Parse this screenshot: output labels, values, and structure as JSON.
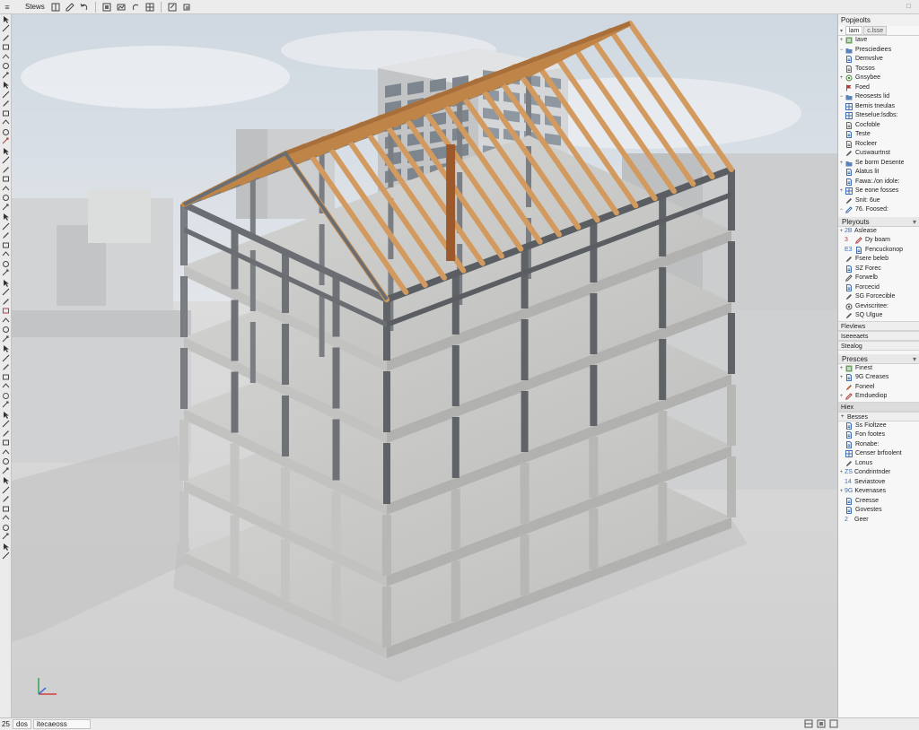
{
  "toolbar": {
    "title": "Stews",
    "buttons": [
      "view-grid-icon",
      "pen-icon",
      "undo-icon",
      "redo-icon",
      "snap-icon",
      "render-icon",
      "grid-icon",
      "export-icon"
    ]
  },
  "left_tools": [
    "arrow-icon",
    "line-icon",
    "pencil-icon",
    "wall-icon",
    "slab-icon",
    "column-icon",
    "beam-icon",
    "roof-icon",
    "brush-icon",
    "text-icon",
    "dimension-icon",
    "measure-icon",
    "paint-icon",
    "eraser-icon",
    "move-icon",
    "rotate-icon",
    "scale-icon",
    "mirror-icon",
    "array-icon",
    "offset-icon",
    "trim-icon",
    "extend-icon",
    "fillet-icon",
    "section-icon",
    "camera-icon",
    "orbit-icon",
    "pan-icon",
    "zoom-icon",
    "zoom-extents-icon",
    "layer-icon",
    "material-icon",
    "light-icon",
    "tag-icon",
    "level-icon",
    "grid-line-icon",
    "stair-icon",
    "door-icon",
    "window-icon",
    "railing-icon",
    "ramp-icon",
    "furniture-icon",
    "component-icon",
    "group-icon",
    "lock-icon",
    "hide-icon",
    "isolate-icon",
    "clip-icon",
    "print-icon",
    "save-icon",
    "lock-small-icon",
    "settings-icon",
    "help-icon",
    "info-icon",
    "plugin-icon",
    "script-icon",
    "camera2-icon",
    "render2-icon",
    "marker-icon"
  ],
  "panel": {
    "title": "Popjeolts",
    "tabs": [
      "lam",
      "c.lsse"
    ],
    "tree": [
      {
        "exp": "+",
        "icon": "layer-icon",
        "color": "#4a8a3c",
        "label": "Iave"
      },
      {
        "exp": "−",
        "icon": "folder-icon",
        "color": "#3f6fb0",
        "label": "Presciediees"
      },
      {
        "exp": "",
        "icon": "doc-icon",
        "color": "#3f6fb0",
        "label": "Demvslve"
      },
      {
        "exp": "",
        "icon": "doc-icon",
        "color": "#6a6a6a",
        "label": "Tocsos"
      },
      {
        "exp": "+",
        "icon": "shape-icon",
        "color": "#4a8a3c",
        "label": "Gnsybee"
      },
      {
        "exp": "",
        "icon": "flag-icon",
        "color": "#b04040",
        "label": "Foed"
      },
      {
        "exp": "−",
        "icon": "folder-icon",
        "color": "#3f6fb0",
        "label": "Reosests lid"
      },
      {
        "exp": "",
        "icon": "grid-icon",
        "color": "#3f6fb0",
        "label": "Bemis tneulas"
      },
      {
        "exp": "",
        "icon": "grid-icon",
        "color": "#3f6fb0",
        "label": "Steselue:lsdbs:"
      },
      {
        "exp": "",
        "icon": "doc-icon",
        "color": "#6a6a6a",
        "label": "Cocfoble"
      },
      {
        "exp": "",
        "icon": "doc-icon",
        "color": "#3f6fb0",
        "label": "Teste"
      },
      {
        "exp": "",
        "icon": "doc-icon",
        "color": "#6a6a6a",
        "label": "Rocleer"
      },
      {
        "exp": "",
        "icon": "pen-icon",
        "color": "#555555",
        "label": "Cuswaurtnst"
      },
      {
        "exp": "+",
        "icon": "folder-icon",
        "color": "#3f6fb0",
        "label": "Se borm Desente"
      },
      {
        "exp": "",
        "icon": "doc-icon",
        "color": "#3f6fb0",
        "label": "Alatus lit"
      },
      {
        "exp": "",
        "icon": "doc-icon",
        "color": "#3f6fb0",
        "label": "Fawa:./on idole:"
      },
      {
        "exp": "+",
        "icon": "grid-icon",
        "color": "#3f6fb0",
        "label": "Se eone fosses"
      },
      {
        "exp": "",
        "icon": "pen-icon",
        "color": "#555555",
        "label": "Snit: 6ue"
      },
      {
        "exp": "−",
        "icon": "pencil-icon",
        "color": "#3f6fb0",
        "label": "76. Foosed:"
      }
    ],
    "playouts_title": "Pleyouts",
    "playouts": [
      {
        "exp": "+",
        "prefix": "2B",
        "color": "#3f6fb0",
        "label": "Aslease"
      },
      {
        "exp": "",
        "prefix": "3",
        "icon": "pencil-icon",
        "color": "#b04040",
        "label": "Dy boam"
      },
      {
        "exp": "",
        "prefix": "E3",
        "icon": "doc-icon",
        "color": "#3f6fb0",
        "label": "Fencuckonop"
      },
      {
        "exp": "",
        "prefix": "",
        "icon": "pen-icon",
        "color": "#555555",
        "label": "Fsere beleb"
      },
      {
        "exp": "",
        "prefix": "",
        "icon": "doc-icon",
        "color": "#3f6fb0",
        "label": "SZ Forec"
      },
      {
        "exp": "",
        "prefix": "",
        "icon": "pencil-icon",
        "color": "#555555",
        "label": "Forwelb"
      },
      {
        "exp": "",
        "prefix": "",
        "icon": "doc-icon",
        "color": "#3f6fb0",
        "label": "Forcecid"
      },
      {
        "exp": "",
        "prefix": "",
        "icon": "pen-icon",
        "color": "#555555",
        "label": "SG Forcecible"
      },
      {
        "exp": "",
        "prefix": "",
        "icon": "shape-icon",
        "color": "#555555",
        "label": "Geviscritee:"
      },
      {
        "exp": "",
        "prefix": "",
        "icon": "pen-icon",
        "color": "#555555",
        "label": "SQ Ulgue"
      }
    ],
    "mid_sections": [
      "Flevlews",
      "Iseeeaets",
      "Stealog"
    ],
    "presets_title": "Presces",
    "presets": [
      {
        "exp": "+",
        "icon": "layer-icon",
        "color": "#4a8a3c",
        "label": "Finest"
      },
      {
        "exp": "+",
        "icon": "doc-icon",
        "color": "#3f6fb0",
        "label": "9G Creases"
      },
      {
        "exp": "",
        "icon": "pen-icon",
        "color": "#b06030",
        "label": "Foneel"
      },
      {
        "exp": "+",
        "icon": "pencil-icon",
        "color": "#b04040",
        "label": "Emduediop"
      }
    ],
    "selected_sections": [
      "Hiex",
      "Besses"
    ],
    "besses": [
      {
        "exp": "",
        "icon": "doc-icon",
        "color": "#3f6fb0",
        "label": "Ss Fioltzee"
      },
      {
        "exp": "",
        "icon": "doc-icon",
        "color": "#3f6fb0",
        "label": "Fon footes"
      },
      {
        "exp": "",
        "icon": "doc-icon",
        "color": "#3f6fb0",
        "label": "Ronabe:"
      },
      {
        "exp": "",
        "icon": "grid-icon",
        "color": "#3f6fb0",
        "label": "Censer brfoolent"
      },
      {
        "exp": "",
        "icon": "pen-icon",
        "color": "#555555",
        "label": "Lonus"
      },
      {
        "exp": "+",
        "prefix": "ZS",
        "color": "#3f6fb0",
        "label": "Condrintnder"
      },
      {
        "exp": "",
        "prefix": "14",
        "color": "#3f6fb0",
        "label": "Seviastove"
      },
      {
        "exp": "+",
        "prefix": "9G",
        "color": "#3f6fb0",
        "label": "Kevenases"
      },
      {
        "exp": "",
        "icon": "doc-icon",
        "color": "#3f6fb0",
        "label": "Creesse"
      },
      {
        "exp": "",
        "icon": "doc-icon",
        "color": "#3f6fb0",
        "label": "Govestes"
      },
      {
        "exp": "",
        "prefix": "2",
        "color": "#3f6fb0",
        "label": "Geer"
      }
    ]
  },
  "status": {
    "left_number": "25",
    "field1": "dos",
    "field2": "itecaeoss"
  },
  "colors": {
    "sky": "#dfe3e8",
    "ground": "#d8d8d8",
    "concrete": "#c9c9c9",
    "steel": "#6e7175",
    "timber": "#c98a52",
    "selection": "#d9e4f2"
  }
}
